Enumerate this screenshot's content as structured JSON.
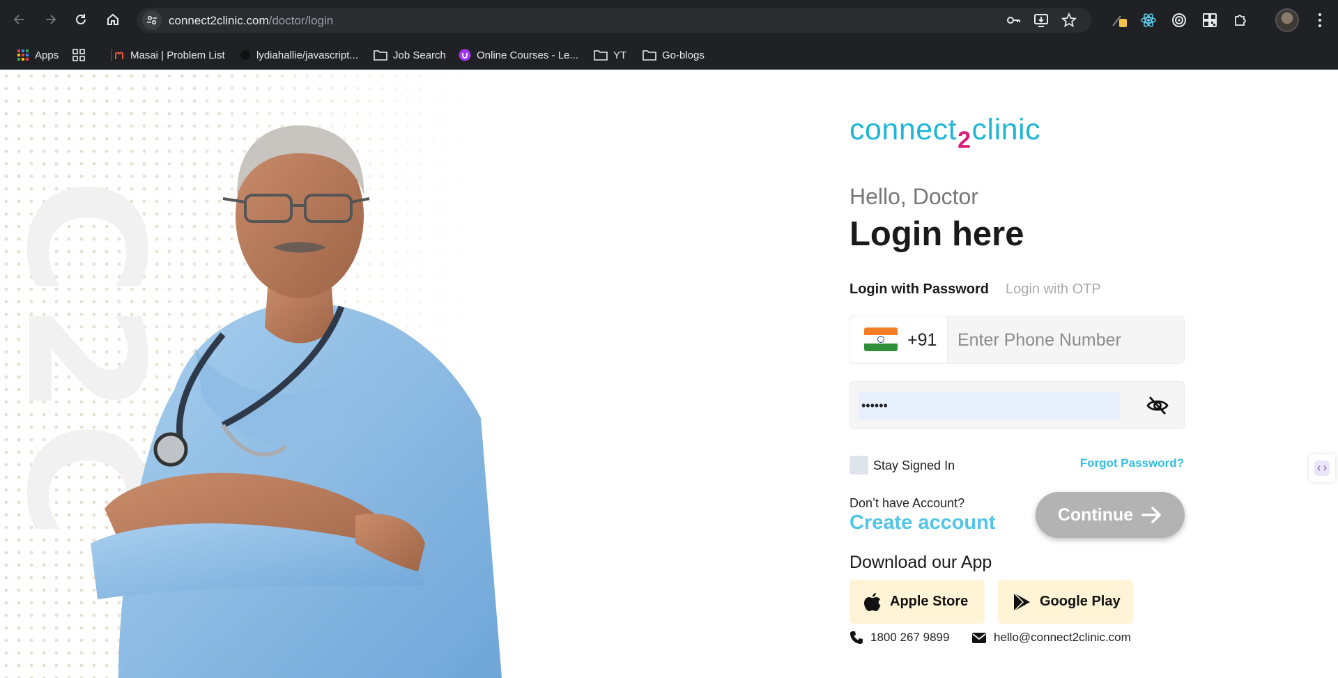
{
  "browser": {
    "url_domain": "connect2clinic.com",
    "url_path": "/doctor/login",
    "bookmarks": [
      {
        "label": "Apps",
        "icon": "apps-grid-icon"
      },
      {
        "label": "",
        "icon": "grid-icon"
      },
      {
        "label": "Masai | Problem List",
        "icon": "masai-favicon"
      },
      {
        "label": "lydiahallie/javascript...",
        "icon": "github-favicon"
      },
      {
        "label": "Job Search",
        "icon": "folder-icon"
      },
      {
        "label": "Online Courses - Le...",
        "icon": "udemy-favicon"
      },
      {
        "label": "YT",
        "icon": "folder-icon"
      },
      {
        "label": "Go-blogs",
        "icon": "folder-icon"
      }
    ]
  },
  "brand": {
    "left": "connect",
    "middle": "2",
    "right": "clinic",
    "watermark": "C2C",
    "primary_color": "#1fb6d4",
    "accent_color": "#d8207b"
  },
  "login": {
    "greeting": "Hello, Doctor",
    "title": "Login here",
    "tab_password": "Login with Password",
    "tab_otp": "Login with OTP",
    "country_code": "+91",
    "phone_placeholder": "Enter Phone Number",
    "password_value": "••••••",
    "stay_signed_in": "Stay Signed In",
    "forgot_password": "Forgot Password?",
    "no_account": "Don’t have Account?",
    "create_account": "Create account",
    "continue": "Continue"
  },
  "app": {
    "download_label": "Download our App",
    "apple": "Apple Store",
    "google": "Google Play"
  },
  "contact": {
    "phone": "1800 267 9899",
    "email": "hello@connect2clinic.com"
  }
}
